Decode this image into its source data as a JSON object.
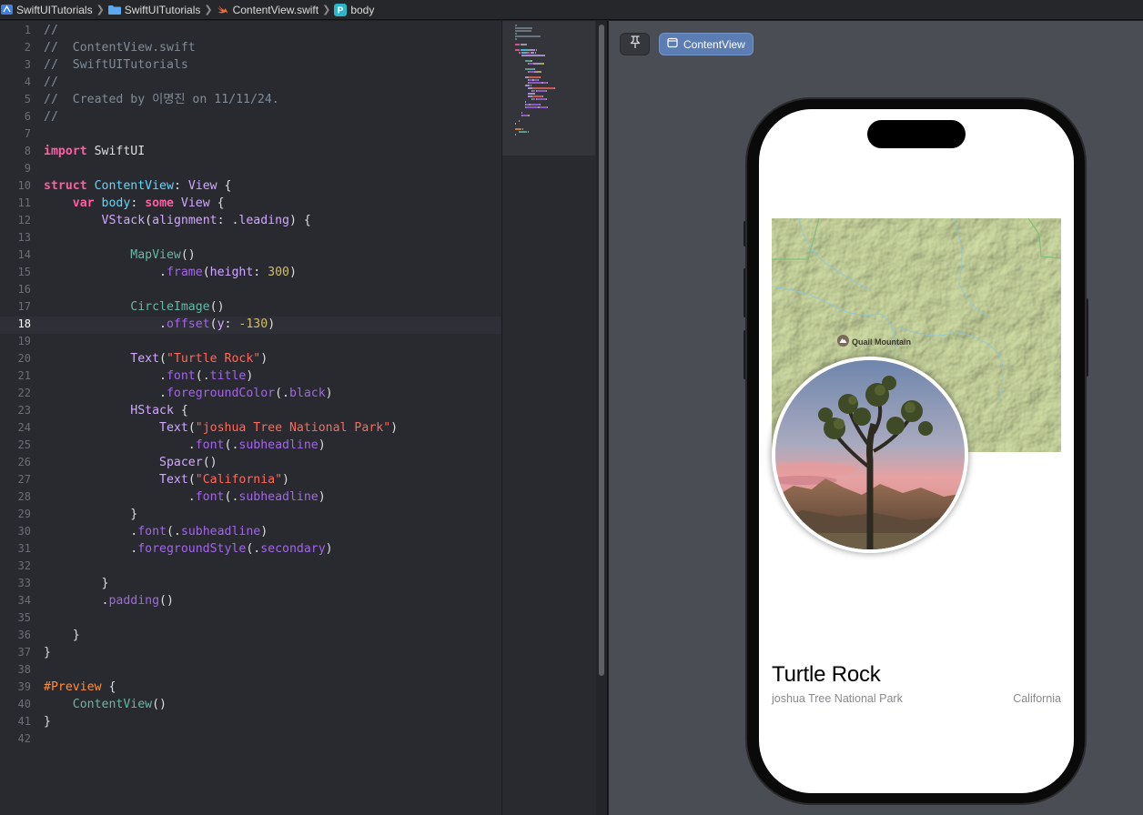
{
  "breadcrumb": [
    "SwiftUITutorials",
    "SwiftUITutorials",
    "ContentView.swift",
    "body"
  ],
  "editor": {
    "current_line": 18,
    "lines": [
      [
        [
          "cm",
          "//"
        ]
      ],
      [
        [
          "cm",
          "//  ContentView.swift"
        ]
      ],
      [
        [
          "cm",
          "//  SwiftUITutorials"
        ]
      ],
      [
        [
          "cm",
          "//"
        ]
      ],
      [
        [
          "cm",
          "//  Created by 이명진 on 11/11/24."
        ]
      ],
      [
        [
          "cm",
          "//"
        ]
      ],
      [],
      [
        [
          "kw",
          "import"
        ],
        [
          "pl",
          " SwiftUI"
        ]
      ],
      [],
      [
        [
          "kw",
          "struct"
        ],
        [
          "pl",
          " "
        ],
        [
          "ty",
          "ContentView"
        ],
        [
          "pl",
          ": "
        ],
        [
          "tn",
          "View"
        ],
        [
          "pl",
          " {"
        ]
      ],
      [
        [
          "pl",
          "    "
        ],
        [
          "kw",
          "var"
        ],
        [
          "pl",
          " "
        ],
        [
          "ty",
          "body"
        ],
        [
          "pl",
          ": "
        ],
        [
          "kw",
          "some"
        ],
        [
          "pl",
          " "
        ],
        [
          "tn",
          "View"
        ],
        [
          "pl",
          " {"
        ]
      ],
      [
        [
          "pl",
          "        "
        ],
        [
          "tn",
          "VStack"
        ],
        [
          "pl",
          "("
        ],
        [
          "pa",
          "alignment"
        ],
        [
          "pl",
          ": ."
        ],
        [
          "pa",
          "leading"
        ],
        [
          "pl",
          ") {"
        ]
      ],
      [],
      [
        [
          "pl",
          "            "
        ],
        [
          "fn",
          "MapView"
        ],
        [
          "pl",
          "()"
        ]
      ],
      [
        [
          "pl",
          "                ."
        ],
        [
          "fm",
          "frame"
        ],
        [
          "pl",
          "("
        ],
        [
          "pa",
          "height"
        ],
        [
          "pl",
          ": "
        ],
        [
          "nu",
          "300"
        ],
        [
          "pl",
          ")"
        ]
      ],
      [],
      [
        [
          "pl",
          "            "
        ],
        [
          "fn",
          "CircleImage"
        ],
        [
          "pl",
          "()"
        ]
      ],
      [
        [
          "pl",
          "                ."
        ],
        [
          "fm",
          "offset"
        ],
        [
          "pl",
          "("
        ],
        [
          "pa",
          "y"
        ],
        [
          "pl",
          ": "
        ],
        [
          "nu",
          "-130"
        ],
        [
          "pl",
          ")"
        ]
      ],
      [],
      [
        [
          "pl",
          "            "
        ],
        [
          "tn",
          "Text"
        ],
        [
          "pl",
          "("
        ],
        [
          "st",
          "\"Turtle Rock\""
        ],
        [
          "pl",
          ")"
        ]
      ],
      [
        [
          "pl",
          "                ."
        ],
        [
          "fm",
          "font"
        ],
        [
          "pl",
          "(."
        ],
        [
          "fm",
          "title"
        ],
        [
          "pl",
          ")"
        ]
      ],
      [
        [
          "pl",
          "                ."
        ],
        [
          "fm",
          "foregroundColor"
        ],
        [
          "pl",
          "(."
        ],
        [
          "fm",
          "black"
        ],
        [
          "pl",
          ")"
        ]
      ],
      [
        [
          "pl",
          "            "
        ],
        [
          "tn",
          "HStack"
        ],
        [
          "pl",
          " {"
        ]
      ],
      [
        [
          "pl",
          "                "
        ],
        [
          "tn",
          "Text"
        ],
        [
          "pl",
          "("
        ],
        [
          "st",
          "\"joshua Tree National Park\""
        ],
        [
          "pl",
          ")"
        ]
      ],
      [
        [
          "pl",
          "                    ."
        ],
        [
          "fm",
          "font"
        ],
        [
          "pl",
          "(."
        ],
        [
          "fm",
          "subheadline"
        ],
        [
          "pl",
          ")"
        ]
      ],
      [
        [
          "pl",
          "                "
        ],
        [
          "tn",
          "Spacer"
        ],
        [
          "pl",
          "()"
        ]
      ],
      [
        [
          "pl",
          "                "
        ],
        [
          "tn",
          "Text"
        ],
        [
          "pl",
          "("
        ],
        [
          "st",
          "\"California\""
        ],
        [
          "pl",
          ")"
        ]
      ],
      [
        [
          "pl",
          "                    ."
        ],
        [
          "fm",
          "font"
        ],
        [
          "pl",
          "(."
        ],
        [
          "fm",
          "subheadline"
        ],
        [
          "pl",
          ")"
        ]
      ],
      [
        [
          "pl",
          "            }"
        ]
      ],
      [
        [
          "pl",
          "            ."
        ],
        [
          "fm",
          "font"
        ],
        [
          "pl",
          "(."
        ],
        [
          "fm",
          "subheadline"
        ],
        [
          "pl",
          ")"
        ]
      ],
      [
        [
          "pl",
          "            ."
        ],
        [
          "fm",
          "foregroundStyle"
        ],
        [
          "pl",
          "(."
        ],
        [
          "fm",
          "secondary"
        ],
        [
          "pl",
          ")"
        ]
      ],
      [],
      [
        [
          "pl",
          "        }"
        ]
      ],
      [
        [
          "pl",
          "        ."
        ],
        [
          "fm",
          "padding"
        ],
        [
          "pl",
          "()"
        ]
      ],
      [],
      [
        [
          "pl",
          "    }"
        ]
      ],
      [
        [
          "pl",
          "}"
        ]
      ],
      [],
      [
        [
          "dir",
          "#Preview"
        ],
        [
          "pl",
          " {"
        ]
      ],
      [
        [
          "pl",
          "    "
        ],
        [
          "fn",
          "ContentView"
        ],
        [
          "pl",
          "()"
        ]
      ],
      [
        [
          "pl",
          "}"
        ]
      ],
      []
    ]
  },
  "canvas": {
    "preview_tab_label": "ContentView",
    "map_label": "Quail Mountain",
    "title": "Turtle Rock",
    "subtitle": "joshua Tree National Park",
    "state": "California"
  },
  "colors": {
    "editor_bg": "#292a30",
    "canvas_bg": "#4a4d53",
    "keyword": "#fc5fa3",
    "type": "#5dd8ff",
    "string": "#fc6a5d",
    "number": "#d0bf69",
    "comment": "#7f8c98"
  },
  "icons": {
    "project": "xcode-project-icon",
    "group": "folder-icon",
    "file": "swift-file-icon",
    "symbol": "property-icon",
    "pin": "pin-icon",
    "preview": "preview-window-icon",
    "map_poi": "mountain-icon"
  }
}
